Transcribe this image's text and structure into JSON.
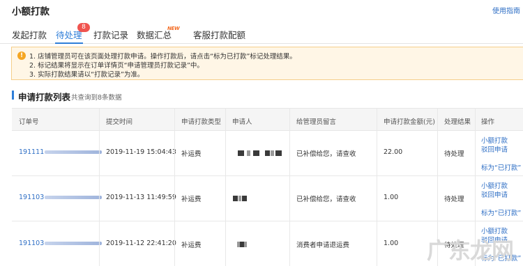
{
  "header": {
    "title": "小额打款",
    "help": "使用指南"
  },
  "tabs": [
    {
      "label": "发起打款"
    },
    {
      "label": "待处理",
      "badge": "8"
    },
    {
      "label": "打款记录"
    },
    {
      "label": "数据汇总",
      "tag": "NEW"
    },
    {
      "label": "客服打款配额"
    }
  ],
  "notice": {
    "icon": "warning-icon",
    "lines": [
      "1. 店铺管理员可在该页面处理打款申请。操作打款后，请点击“标为已打款”标记处理结果。",
      "2. 标记结果将显示在订单详情页“申请管理员打款记录”中。",
      "3. 实际打款结果请以“打款记录”为准。"
    ]
  },
  "section": {
    "title": "申请打款列表",
    "count": "共查询到8条数据"
  },
  "table": {
    "columns": [
      "订单号",
      "提交时间",
      "申请打款类型",
      "申请人",
      "给管理员留言",
      "申请打款金额(元)",
      "处理结果",
      "操作"
    ],
    "rows": [
      {
        "order": "191111",
        "time": "2019-11-19 15:04:43",
        "type": "补运费",
        "message": "已补偿给您，请查收",
        "amount": "22.00",
        "status": "待处理",
        "actions": [
          "小额打款",
          "驳回申请",
          "标为“已打款”"
        ]
      },
      {
        "order": "191103",
        "time": "2019-11-13 11:49:59",
        "type": "补运费",
        "message": "已补偿给您，请查收",
        "amount": "1.00",
        "status": "待处理",
        "actions": [
          "小额打款",
          "驳回申请",
          "标为“已打款”"
        ]
      },
      {
        "order": "191103",
        "time": "2019-11-12 22:41:20",
        "type": "补运费",
        "message": "消费者申请退运费",
        "amount": "1.00",
        "status": "待处理",
        "actions": [
          "小额打款",
          "驳回申请",
          "标为“已打款”"
        ]
      }
    ]
  },
  "watermark": "广东龙网",
  "colors": {
    "accent": "#2f7ed8",
    "link": "#2f6fc5",
    "badge": "#f0544f",
    "notice_bg": "#fff6e6",
    "notice_border": "#f5ce8a"
  }
}
